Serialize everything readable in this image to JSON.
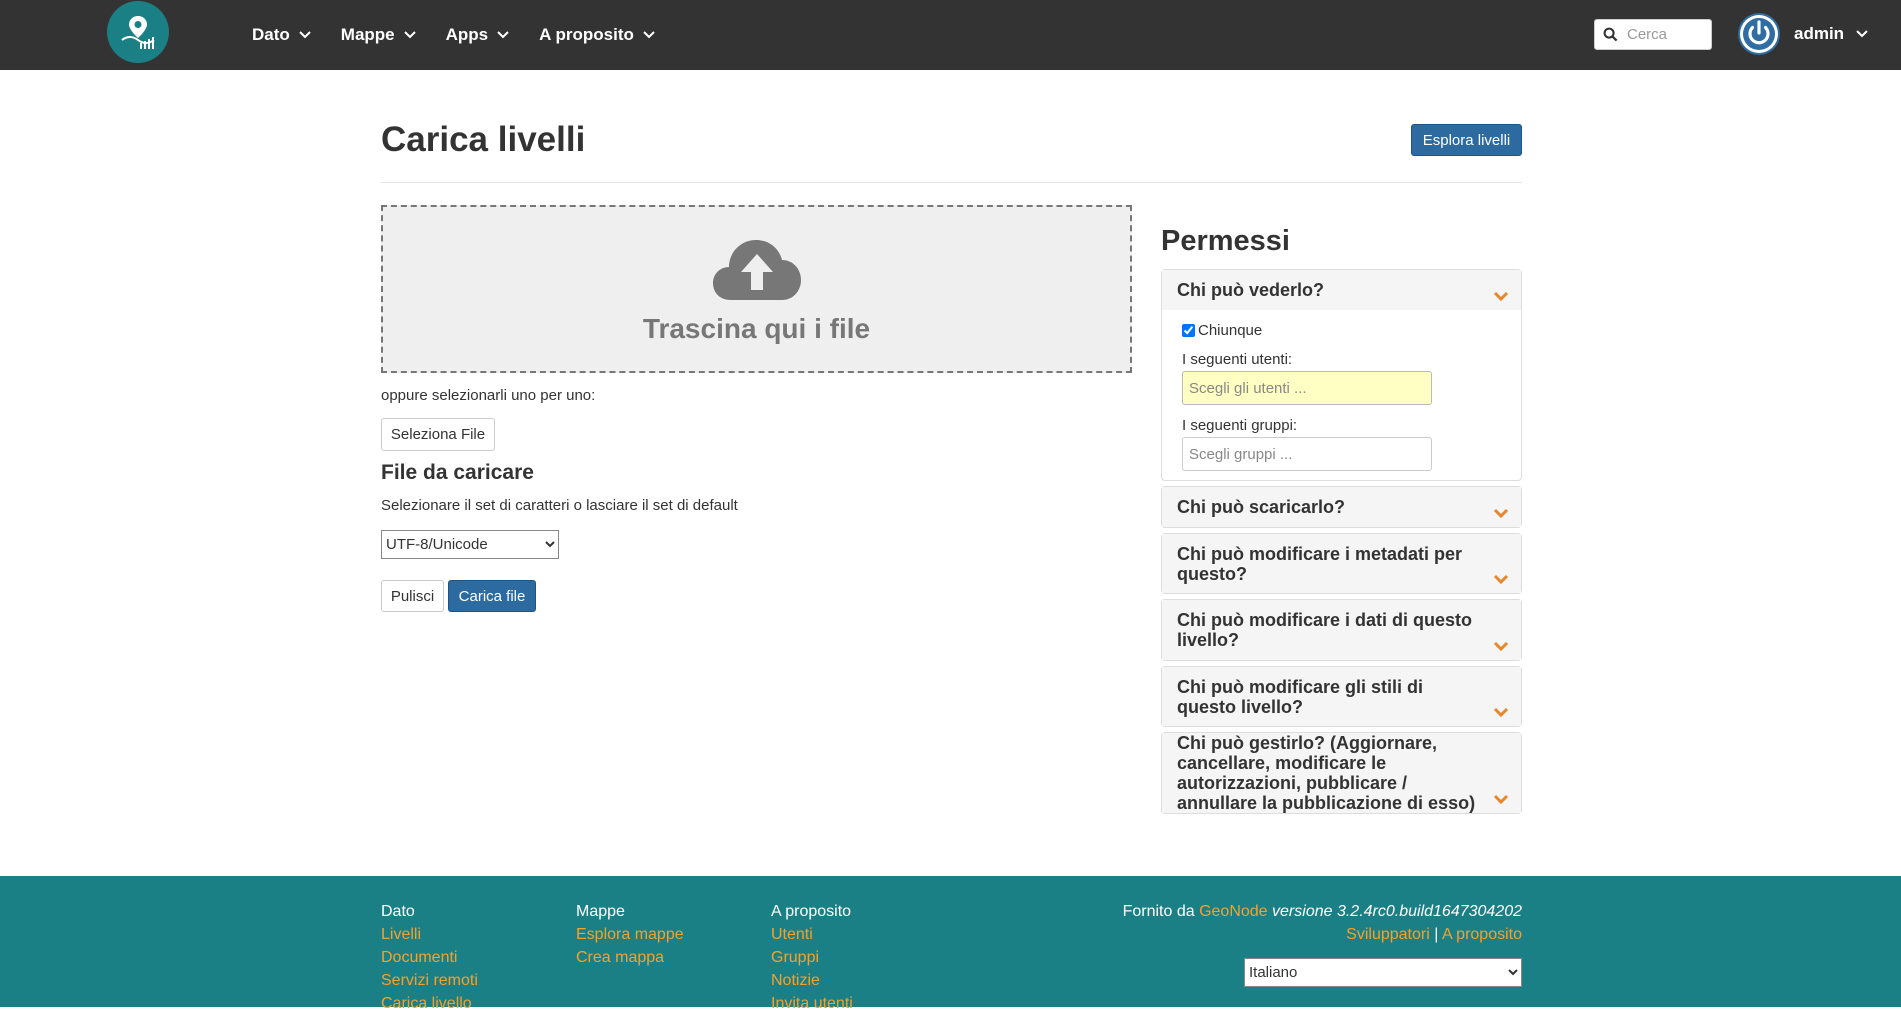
{
  "nav": {
    "items": [
      {
        "label": "Dato"
      },
      {
        "label": "Mappe"
      },
      {
        "label": "Apps"
      },
      {
        "label": "A proposito"
      }
    ],
    "search_placeholder": "Cerca",
    "user": "admin"
  },
  "page": {
    "title": "Carica livelli",
    "explore_button": "Esplora livelli"
  },
  "upload": {
    "drop_text": "Trascina qui i file",
    "or_text": "oppure selezionarli uno per uno:",
    "select_button": "Seleziona File",
    "files_title": "File da caricare",
    "charset_hint": "Selezionare il set di caratteri o lasciare il set di default",
    "charset_value": "UTF-8/Unicode",
    "clear_button": "Pulisci",
    "upload_button": "Carica file"
  },
  "permissions": {
    "title": "Permessi",
    "view": {
      "heading": "Chi può vederlo?",
      "anyone_label": "Chiunque",
      "anyone_checked": true,
      "users_label": "I seguenti utenti:",
      "users_placeholder": "Scegli gli utenti ...",
      "groups_label": "I seguenti gruppi:",
      "groups_placeholder": "Scegli gruppi ..."
    },
    "download": "Chi può scaricarlo?",
    "edit_metadata": "Chi può modificare i metadati per questo?",
    "edit_data": "Chi può modificare i dati di questo livello?",
    "edit_styles": "Chi può modificare gli stili di questo livello?",
    "manage": "Chi può gestirlo? (Aggiornare, cancellare, modificare le autorizzazioni, pubblicare / annullare la pubblicazione di esso)"
  },
  "footer": {
    "col1": {
      "head": "Dato",
      "links": [
        "Livelli",
        "Documenti",
        "Servizi remoti",
        "Carica livello"
      ]
    },
    "col2": {
      "head": "Mappe",
      "links": [
        "Esplora mappe",
        "Crea mappa"
      ]
    },
    "col3": {
      "head": "A proposito",
      "links": [
        "Utenti",
        "Gruppi",
        "Notizie",
        "Invita utenti"
      ]
    },
    "powered_prefix": "Fornito da",
    "geonode": "GeoNode",
    "version": "versione 3.2.4rc0.build1647304202",
    "developers": "Sviluppatori",
    "separator": "|",
    "about": "A proposito",
    "language": "Italiano"
  },
  "colors": {
    "navbar": "#333333",
    "primary": "#2c6aa0",
    "footer": "#1b7f86",
    "accent": "#f6a12a",
    "chevron": "#e8862c"
  },
  "icons": {
    "logo": "map-pin-logo-icon",
    "search": "search-icon",
    "user": "power-icon",
    "upload": "cloud-upload-icon",
    "expand": "chevron-down-icon"
  }
}
